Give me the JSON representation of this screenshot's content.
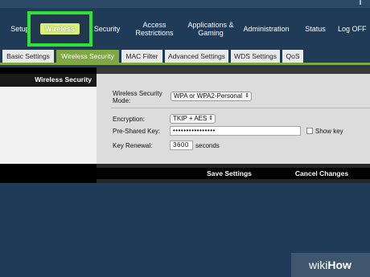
{
  "nav": {
    "items": [
      "Setup",
      "Wireless",
      "Security",
      "Access Restrictions",
      "Applications & Gaming",
      "Administration",
      "Status",
      "Log OFF"
    ]
  },
  "subtabs": [
    "Basic Settings",
    "Wireless Security",
    "MAC Filter",
    "Advanced Settings",
    "WDS Settings",
    "QoS"
  ],
  "section_title": "Wireless Security",
  "form": {
    "mode_label": "Wireless Security Mode:",
    "mode_value": "WPA or WPA2-Personal",
    "encryption_label": "Encryption:",
    "encryption_value": "TKIP + AES",
    "psk_label": "Pre-Shared Key:",
    "psk_value": "••••••••••••••••",
    "show_key_label": "Show key",
    "renewal_label": "Key Renewal:",
    "renewal_value": "3600",
    "renewal_unit": "seconds"
  },
  "buttons": {
    "save": "Save Settings",
    "cancel": "Cancel Changes"
  },
  "watermark": {
    "text_a": "wiki",
    "text_b": "How"
  },
  "colors": {
    "background": "#1f3b57",
    "highlight": "#2fe234",
    "tab_active": "#7fa744"
  }
}
